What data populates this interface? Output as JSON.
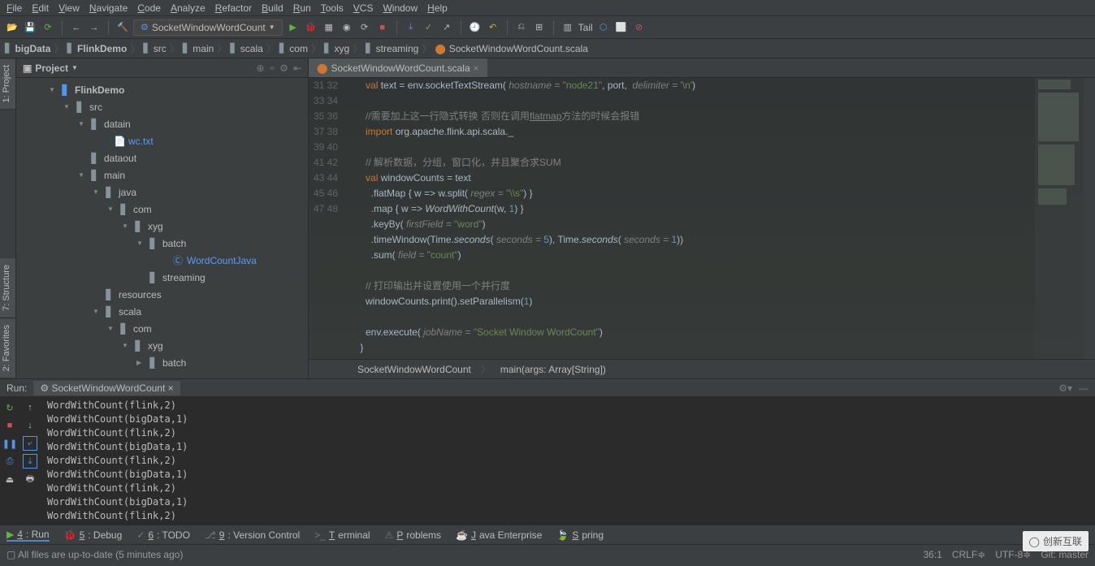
{
  "menu": [
    "File",
    "Edit",
    "View",
    "Navigate",
    "Code",
    "Analyze",
    "Refactor",
    "Build",
    "Run",
    "Tools",
    "VCS",
    "Window",
    "Help"
  ],
  "run_config": "SocketWindowWordCount",
  "breadcrumbs": [
    {
      "label": "bigData",
      "icon": "folder",
      "bold": true
    },
    {
      "label": "FlinkDemo",
      "icon": "folder",
      "bold": true
    },
    {
      "label": "src",
      "icon": "folder"
    },
    {
      "label": "main",
      "icon": "folder"
    },
    {
      "label": "scala",
      "icon": "folder"
    },
    {
      "label": "com",
      "icon": "folder"
    },
    {
      "label": "xyg",
      "icon": "folder"
    },
    {
      "label": "streaming",
      "icon": "folder"
    },
    {
      "label": "SocketWindowWordCount.scala",
      "icon": "scala"
    }
  ],
  "project_title": "Project",
  "tree": [
    {
      "indent": 40,
      "arrow": "▼",
      "icon": "mod",
      "label": "FlinkDemo",
      "bold": true
    },
    {
      "indent": 58,
      "arrow": "▼",
      "icon": "folder",
      "label": "src"
    },
    {
      "indent": 76,
      "arrow": "▼",
      "icon": "folder",
      "label": "datain"
    },
    {
      "indent": 106,
      "arrow": "",
      "icon": "txt",
      "label": "wc.txt",
      "link": true
    },
    {
      "indent": 76,
      "arrow": "",
      "icon": "folder",
      "label": "dataout"
    },
    {
      "indent": 76,
      "arrow": "▼",
      "icon": "folder",
      "label": "main"
    },
    {
      "indent": 94,
      "arrow": "▼",
      "icon": "folder",
      "label": "java"
    },
    {
      "indent": 112,
      "arrow": "▼",
      "icon": "folder",
      "label": "com"
    },
    {
      "indent": 130,
      "arrow": "▼",
      "icon": "folder",
      "label": "xyg"
    },
    {
      "indent": 148,
      "arrow": "▼",
      "icon": "folder",
      "label": "batch"
    },
    {
      "indent": 178,
      "arrow": "",
      "icon": "class",
      "label": "WordCountJava",
      "link": true
    },
    {
      "indent": 148,
      "arrow": "",
      "icon": "folder",
      "label": "streaming"
    },
    {
      "indent": 94,
      "arrow": "",
      "icon": "folder",
      "label": "resources"
    },
    {
      "indent": 94,
      "arrow": "▼",
      "icon": "folder",
      "label": "scala"
    },
    {
      "indent": 112,
      "arrow": "▼",
      "icon": "folder",
      "label": "com"
    },
    {
      "indent": 130,
      "arrow": "▼",
      "icon": "folder",
      "label": "xyg"
    },
    {
      "indent": 148,
      "arrow": "▶",
      "icon": "folder",
      "label": "batch"
    }
  ],
  "editor_tab": "SocketWindowWordCount.scala",
  "line_start": 31,
  "editor_breadcrumb": {
    "class": "SocketWindowWordCount",
    "method": "main(args: Array[String])"
  },
  "run_label": "Run:",
  "run_tab": "SocketWindowWordCount",
  "output": [
    "WordWithCount(flink,2)",
    "WordWithCount(bigData,1)",
    "WordWithCount(flink,2)",
    "WordWithCount(bigData,1)",
    "WordWithCount(flink,2)",
    "WordWithCount(bigData,1)",
    "WordWithCount(flink,2)",
    "WordWithCount(bigData,1)",
    "WordWithCount(flink,2)"
  ],
  "bottom_tabs": [
    {
      "icon": "▶",
      "label": "4: Run",
      "active": true
    },
    {
      "icon": "🐞",
      "label": "5: Debug"
    },
    {
      "icon": "✓",
      "label": "6: TODO"
    },
    {
      "icon": "⎇",
      "label": "9: Version Control"
    },
    {
      "icon": ">_",
      "label": "Terminal"
    },
    {
      "icon": "⚠",
      "label": "Problems"
    },
    {
      "icon": "☕",
      "label": "Java Enterprise"
    },
    {
      "icon": "🍃",
      "label": "Spring"
    }
  ],
  "status_left": "All files are up-to-date (5 minutes ago)",
  "status_right": {
    "pos": "36:1",
    "crlf": "CRLF",
    "enc": "UTF-8",
    "git": "Git: master"
  },
  "left_tabs": [
    "1: Project",
    "7: Structure",
    "2: Favorites"
  ],
  "watermark": "创新互联",
  "tail_label": "Tail"
}
